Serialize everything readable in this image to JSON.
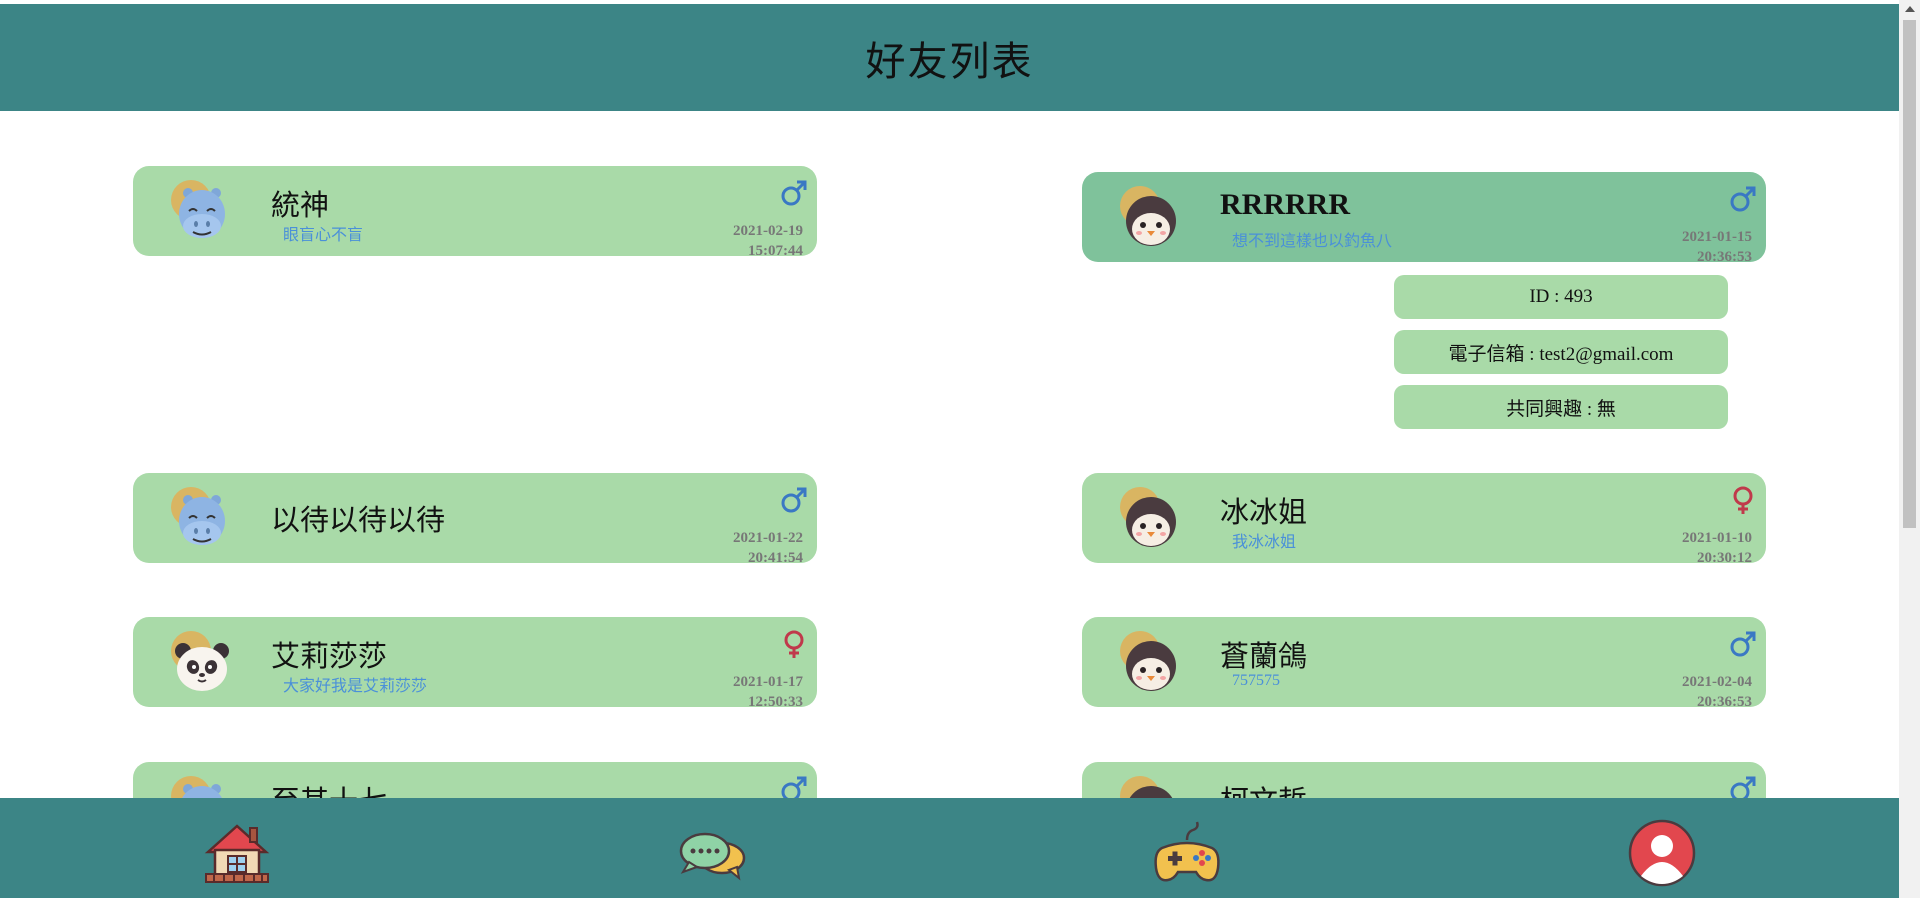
{
  "header": {
    "title": "好友列表"
  },
  "friends": [
    {
      "name": "統神",
      "bio": "眼盲心不盲",
      "gender": "male",
      "avatar": "hippo",
      "date": "2021-02-19",
      "time": "15:07:44"
    },
    {
      "name": "RRRRRR",
      "bio": "想不到這樣也以釣魚八",
      "gender": "male",
      "avatar": "penguin",
      "date": "2021-01-15",
      "time": "20:36:53"
    },
    {
      "name": "以待以待以待",
      "bio": "",
      "gender": "male",
      "avatar": "hippo",
      "date": "2021-01-22",
      "time": "20:41:54"
    },
    {
      "name": "冰冰姐",
      "bio": "我冰冰姐",
      "gender": "female",
      "avatar": "penguin",
      "date": "2021-01-10",
      "time": "20:30:12"
    },
    {
      "name": "艾莉莎莎",
      "bio": "大家好我是艾莉莎莎",
      "gender": "female",
      "avatar": "panda",
      "date": "2021-01-17",
      "time": "12:50:33"
    },
    {
      "name": "蒼蘭鴿",
      "bio": "757575",
      "gender": "male",
      "avatar": "penguin",
      "date": "2021-02-04",
      "time": "20:36:53"
    },
    {
      "name": "至其十七",
      "gender": "male",
      "avatar": "hippo"
    },
    {
      "name": "柯文哲",
      "gender": "male",
      "avatar": "penguin"
    }
  ],
  "selected_detail": {
    "id": "ID : 493",
    "email": "電子信箱 : test2@gmail.com",
    "common_interest": "共同興趣 : 無"
  },
  "nav": {
    "items": [
      {
        "name": "home",
        "icon": "house-icon"
      },
      {
        "name": "chat",
        "icon": "chat-bubbles-icon"
      },
      {
        "name": "game",
        "icon": "gamepad-icon"
      },
      {
        "name": "profile",
        "icon": "user-avatar-icon"
      }
    ]
  },
  "colors": {
    "header_bg": "#3c8586",
    "card_bg": "#a9daa8",
    "card_selected_bg": "#7fc29b",
    "bio_text": "#4a90d9",
    "male": "#3a78c4",
    "female": "#c0394b"
  }
}
